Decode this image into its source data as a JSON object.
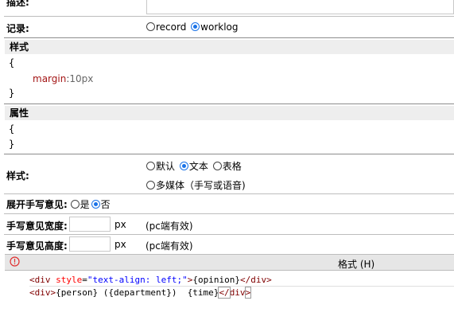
{
  "description": {
    "label": "描述:"
  },
  "record": {
    "label": "记录:",
    "options": [
      {
        "label": "record",
        "checked": false
      },
      {
        "label": "worklog",
        "checked": true
      }
    ]
  },
  "style_section": {
    "title": "样式",
    "open_brace": "{",
    "property": "margin",
    "colon": ":",
    "value": "10px",
    "close_brace": "}"
  },
  "attr_section": {
    "title": "属性",
    "open_brace": "{",
    "close_brace": "}"
  },
  "display_style": {
    "label": "样式:",
    "options": [
      {
        "label": "默认",
        "checked": false
      },
      {
        "label": "文本",
        "checked": true
      },
      {
        "label": "表格",
        "checked": false
      },
      {
        "label": "多媒体（手写或语音)",
        "checked": false
      }
    ]
  },
  "expand_handwriting": {
    "label": "展开手写意见:",
    "options": [
      {
        "label": "是",
        "checked": false
      },
      {
        "label": "否",
        "checked": true
      }
    ]
  },
  "handwriting_width": {
    "label": "手写意见宽度:",
    "value": "",
    "unit": "px",
    "note": "(pc端有效)"
  },
  "handwriting_height": {
    "label": "手写意见高度:",
    "value": "",
    "unit": "px",
    "note": "(pc端有效)"
  },
  "editor": {
    "error_icon": "error-circle-icon",
    "format_label": "格式 (H)",
    "line1": {
      "open_tag": "<div ",
      "attr_name": "style",
      "eq": "=",
      "attr_value": "\"text-align: left;\"",
      "close_bracket": ">",
      "content": "{opinion}",
      "end_tag": "</div>"
    },
    "line2": {
      "open_tag": "<div>",
      "content": "{person} ({department})  {time}",
      "end_tag_open": "</",
      "end_tag_name": "div",
      "end_tag_close": ">"
    }
  }
}
